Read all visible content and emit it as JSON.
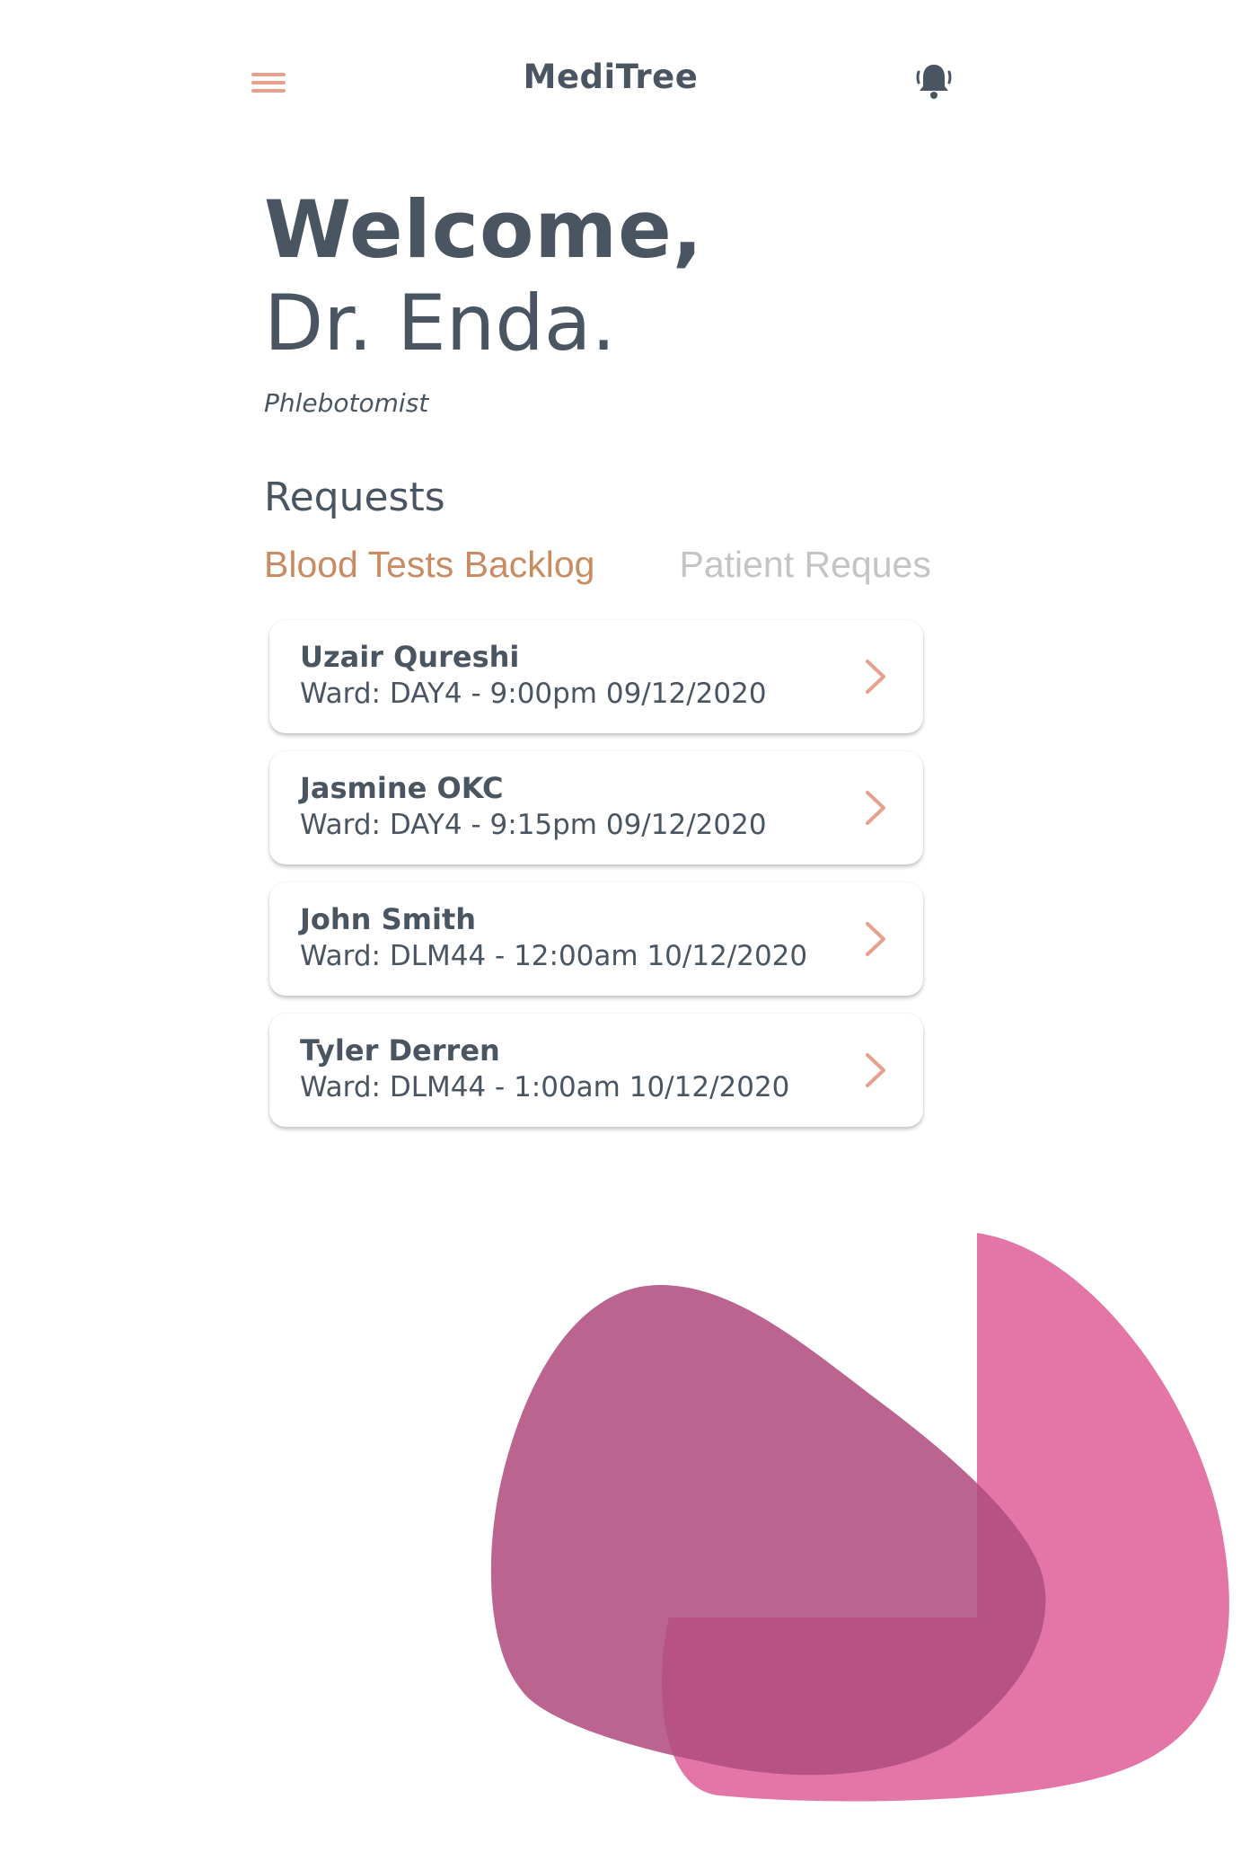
{
  "header": {
    "title": "MediTree",
    "menu_icon": "hamburger-menu-icon",
    "bell_icon": "bell-icon"
  },
  "welcome": {
    "greeting": "Welcome,",
    "name": "Dr. Enda.",
    "role": "Phlebotomist"
  },
  "requests": {
    "title": "Requests",
    "tabs": [
      {
        "label": "Blood Tests Backlog",
        "active": true
      },
      {
        "label": "Patient Requests",
        "active": false
      }
    ],
    "items": [
      {
        "name": "Uzair Qureshi",
        "detail": "Ward: DAY4 - 9:00pm 09/12/2020"
      },
      {
        "name": "Jasmine OKC",
        "detail": "Ward: DAY4 - 9:15pm 09/12/2020"
      },
      {
        "name": "John Smith",
        "detail": "Ward: DLM44 - 12:00am 10/12/2020"
      },
      {
        "name": "Tyler Derren",
        "detail": "Ward: DLM44 - 1:00am 10/12/2020"
      }
    ]
  },
  "colors": {
    "accent": "#e8a08f",
    "tab_active": "#c98b62",
    "tab_inactive": "#c4c4c4",
    "text": "#4a5562",
    "blob_pink": "#e26ea2",
    "blob_plum": "#b9608b"
  }
}
